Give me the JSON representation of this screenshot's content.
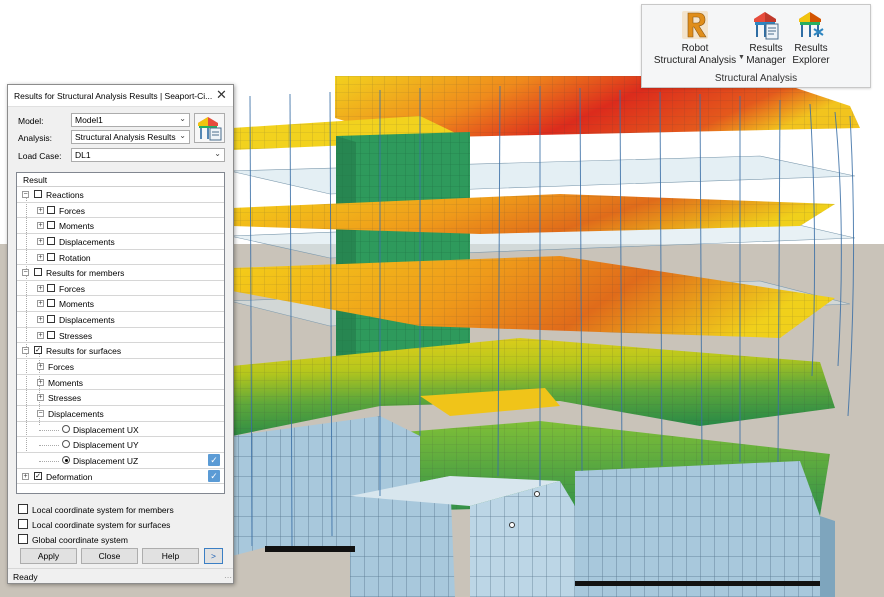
{
  "ribbon": {
    "robot_line1": "Robot",
    "robot_line2": "Structural Analysis",
    "manager_line1": "Results",
    "manager_line2": "Manager",
    "explorer_line1": "Results",
    "explorer_line2": "Explorer",
    "group_label": "Structural Analysis",
    "caret_icon": "chevron-down-icon"
  },
  "dialog": {
    "title": "Results for Structural Analysis Results | Seaport-Ci...",
    "model_label": "Model:",
    "model_value": "Model1",
    "analysis_label": "Analysis:",
    "analysis_value": "Structural Analysis Results",
    "loadcase_label": "Load Case:",
    "loadcase_value": "DL1",
    "tree_header": "Result",
    "tree": {
      "reactions": "Reactions",
      "r_forces": "Forces",
      "r_moments": "Moments",
      "r_displacements": "Displacements",
      "r_rotation": "Rotation",
      "members": "Results for members",
      "m_forces": "Forces",
      "m_moments": "Moments",
      "m_displacements": "Displacements",
      "m_stresses": "Stresses",
      "surfaces": "Results for surfaces",
      "s_forces": "Forces",
      "s_moments": "Moments",
      "s_stresses": "Stresses",
      "s_displacements": "Displacements",
      "ux": "Displacement UX",
      "uy": "Displacement UY",
      "uz": "Displacement UZ",
      "deformation": "Deformation"
    },
    "opt_members": "Local coordinate system for members",
    "opt_surfaces": "Local coordinate system for surfaces",
    "opt_global": "Global coordinate system",
    "apply": "Apply",
    "close": "Close",
    "help": "Help",
    "more": ">",
    "status": "Ready"
  },
  "colors": {
    "accent": "#5b9bd5",
    "sky": "#ffffff",
    "ground": "#c9c3b9",
    "facade": "#a8c8dc",
    "core": "#2e9a5c",
    "slab_high": "#d92b1f",
    "slab_mid": "#f2d21e",
    "slab_low": "#2f9a47"
  }
}
